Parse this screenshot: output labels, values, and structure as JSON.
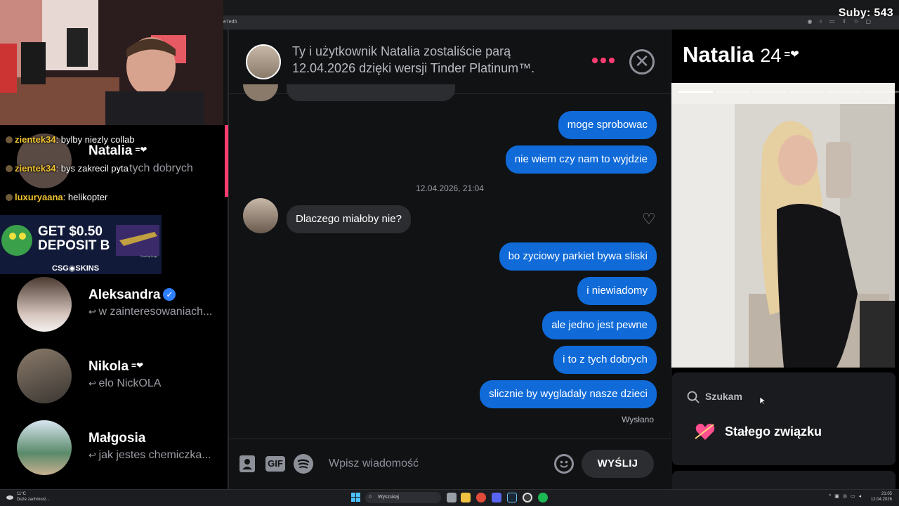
{
  "overlay": {
    "subscribers_label": "Suby: 543",
    "url_fragment": "e7ed5",
    "chat": [
      {
        "user": "zientek34",
        "text": ": bylby niezly collab"
      },
      {
        "user": "zientek34",
        "text": ": bys zakrecil pyta"
      },
      {
        "user": "luxuryaana",
        "text": ": helikopter"
      }
    ],
    "ad": {
      "headline_1": "GET $0.50",
      "headline_2": "DEPOSIT B",
      "brand": "CSG◉SKINS",
      "small_1": "Soaring Auge"
    }
  },
  "sidebar": {
    "matches": [
      {
        "name": "Natalia",
        "badge": "beat",
        "preview": "tych dobrych"
      },
      {
        "name": "Aleksandra",
        "badge": "verified",
        "preview": "w zainteresowaniach..."
      },
      {
        "name": "Nikola",
        "badge": "beat",
        "preview": "elo NickOLA"
      },
      {
        "name": "Małgosia",
        "badge": "",
        "preview": "jak jestes chemiczka..."
      }
    ],
    "reply_icon": "reply-arrow-icon",
    "verified_glyph": "✓",
    "beat_glyph": "=❤"
  },
  "header": {
    "match_text": "Ty i użytkownik Natalia zostaliście parą 12.04.2026 dzięki wersji Tinder Platinum™.",
    "close_glyph": "✕"
  },
  "messages": [
    {
      "dir": "out",
      "text": "moge sprobowac"
    },
    {
      "dir": "out",
      "text": "nie wiem czy nam to wyjdzie"
    },
    {
      "dir": "ts",
      "text": "12.04.2026, 21:04"
    },
    {
      "dir": "in",
      "text": "Dlaczego miałoby nie?"
    },
    {
      "dir": "out",
      "text": "bo zyciowy parkiet bywa sliski"
    },
    {
      "dir": "out",
      "text": "i niewiadomy"
    },
    {
      "dir": "out",
      "text": "ale jedno jest pewne"
    },
    {
      "dir": "out",
      "text": "i to z tych dobrych"
    },
    {
      "dir": "out",
      "text": "slicznie by wygladaly nasze dzieci"
    }
  ],
  "sent_label": "Wysłano",
  "composer": {
    "gif_label": "GIF",
    "placeholder": "Wpisz wiadomość",
    "send_label": "WYŚLIJ",
    "emoji_glyph": "☺"
  },
  "profile": {
    "name": "Natalia",
    "age": "24",
    "beat_glyph": "=❤",
    "photo_count": 6,
    "photo_index": 1,
    "looking_for_label": "Szukam",
    "looking_for_value": "Stałego związku"
  },
  "taskbar": {
    "search_label": "Wyszukaj",
    "weather_temp": "11°C",
    "weather_text": "Duże zachmurz...",
    "time": "21:05",
    "date": "12.04.2026"
  },
  "colors": {
    "accent": "#fe3c72",
    "bubble_out": "#106bd9",
    "bubble_in": "#2c2d31",
    "verified": "#2f80ff"
  }
}
